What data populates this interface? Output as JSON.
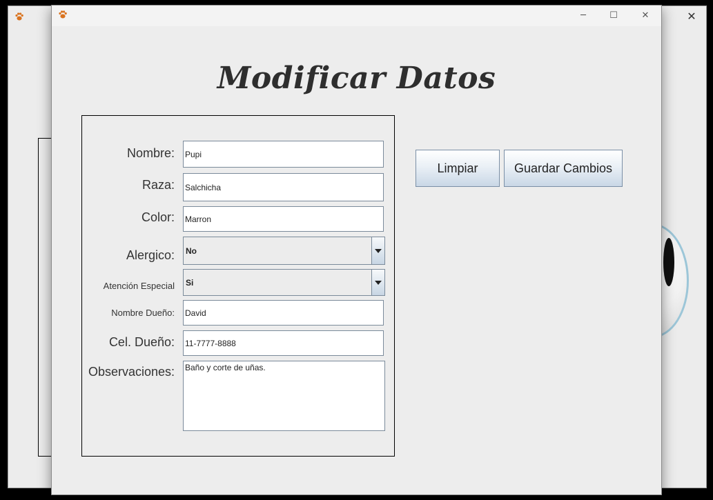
{
  "dialog": {
    "heading": "Modificar Datos"
  },
  "form": {
    "nombre": {
      "label": "Nombre:",
      "value": "Pupi"
    },
    "raza": {
      "label": "Raza:",
      "value": "Salchicha"
    },
    "color": {
      "label": "Color:",
      "value": "Marron"
    },
    "alergico": {
      "label": "Alergico:",
      "value": "No"
    },
    "atencion": {
      "label": "Atención Especial",
      "value": "Si"
    },
    "dueno": {
      "label": "Nombre Dueño:",
      "value": "David"
    },
    "cel": {
      "label": "Cel. Dueño:",
      "value": "11-7777-8888"
    },
    "obs": {
      "label": "Observaciones:",
      "value": "Baño y corte de uñas."
    }
  },
  "buttons": {
    "limpiar": "Limpiar",
    "guardar": "Guardar Cambios"
  },
  "window_controls": {
    "minimize": "─",
    "maximize": "☐",
    "close": "✕"
  },
  "icons": {
    "app": "paw-icon",
    "dropdown": "chevron-down-icon"
  },
  "colors": {
    "dialog_bg": "#ededed",
    "button_gradient_end": "#c9d7e6",
    "title_text": "#2e2e2e"
  }
}
